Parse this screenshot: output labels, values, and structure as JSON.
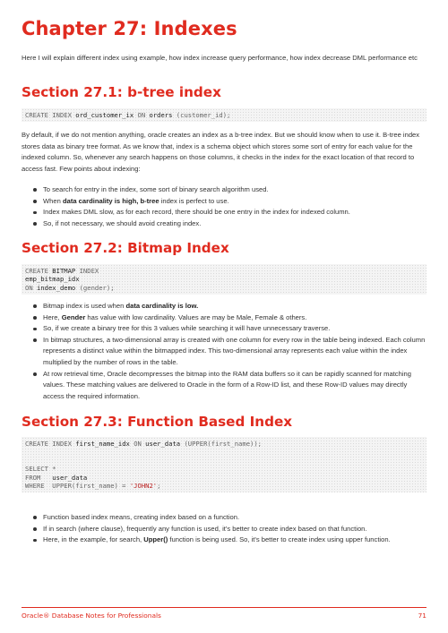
{
  "chapter": {
    "title": "Chapter 27: Indexes",
    "intro": "Here I will explain different index using example, how index increase query performance, how index decrease DML performance etc"
  },
  "s1": {
    "title": "Section 27.1: b-tree index",
    "code": [
      [
        [
          "CREATE INDEX ",
          "kw"
        ],
        [
          "ord_customer_ix",
          "id"
        ],
        [
          " ON ",
          "kw"
        ],
        [
          "orders ",
          "id"
        ],
        [
          "(customer_id);",
          "kw"
        ]
      ]
    ],
    "para": "By default, if we do not mention anything, oracle creates an index as a b-tree index. But we should know when to use it. B-tree index stores data as binary tree format. As we know that, index is a schema object which stores some sort of entry for each value for the indexed column. So, whenever any search happens on those columns, it checks in the index for the exact location of that record to access fast. Few points about indexing:",
    "bullets": [
      [
        [
          "To search for entry in the index, some sort of binary search algorithm used.",
          ""
        ]
      ],
      [
        [
          "When ",
          ""
        ],
        [
          "data cardinality is high, b-tree",
          "b"
        ],
        [
          " index is perfect to use.",
          ""
        ]
      ],
      [
        [
          "Index makes DML slow, as for each record, there should be one entry in the index for indexed column.",
          ""
        ]
      ],
      [
        [
          "So, if not necessary, we should avoid creating index.",
          ""
        ]
      ]
    ]
  },
  "s2": {
    "title": "Section 27.2: Bitmap Index",
    "code": [
      [
        [
          "CREATE ",
          "kw"
        ],
        [
          "BITMAP ",
          "id"
        ],
        [
          "INDEX",
          "kw"
        ]
      ],
      [
        [
          "emp_bitmap_idx",
          "id"
        ]
      ],
      [
        [
          "ON ",
          "kw"
        ],
        [
          "index_demo ",
          "id"
        ],
        [
          "(gender);",
          "kw"
        ]
      ]
    ],
    "bullets": [
      [
        [
          "Bitmap index is used when ",
          ""
        ],
        [
          "data cardinality is low.",
          "b"
        ]
      ],
      [
        [
          "Here, ",
          ""
        ],
        [
          "Gender",
          "b"
        ],
        [
          " has value with low cardinality. Values are may be Male, Female & others.",
          ""
        ]
      ],
      [
        [
          "So, if we create a binary tree for this 3 values while searching it will have unnecessary traverse.",
          ""
        ]
      ],
      [
        [
          "In bitmap structures, a two-dimensional array is created with one column for every row in the table being indexed. Each column represents a distinct value within the bitmapped index. This two-dimensional array represents each value within the index multiplied by the number of rows in the table.",
          ""
        ]
      ],
      [
        [
          "At row retrieval time, Oracle decompresses the bitmap into the RAM data buffers so it can be rapidly scanned for matching values. These matching values are delivered to Oracle in the form of a Row-ID list, and these Row-ID values may directly access the required information.",
          ""
        ]
      ]
    ]
  },
  "s3": {
    "title": "Section 27.3: Function Based Index",
    "code": [
      [
        [
          "CREATE INDEX ",
          "kw"
        ],
        [
          "first_name_idx ",
          "id"
        ],
        [
          "ON ",
          "kw"
        ],
        [
          "user_data ",
          "id"
        ],
        [
          "(UPPER(first_name));",
          "kw"
        ]
      ],
      [
        [
          "",
          ""
        ]
      ],
      [
        [
          "",
          ""
        ]
      ],
      [
        [
          "SELECT ",
          "kw"
        ],
        [
          "*",
          "kw"
        ]
      ],
      [
        [
          "FROM   ",
          "kw"
        ],
        [
          "user_data",
          "id"
        ]
      ],
      [
        [
          "WHERE  UPPER(first_name) = ",
          "kw"
        ],
        [
          "'JOHN2'",
          "str"
        ],
        [
          ";",
          "kw"
        ]
      ]
    ],
    "bullets": [
      [
        [
          "Function based index means, creating index based on a function.",
          ""
        ]
      ],
      [
        [
          "If in search (where clause), frequently any function is used, it's better to create index based on that function.",
          ""
        ]
      ],
      [
        [
          "Here, in the example, for search, ",
          ""
        ],
        [
          "Upper()",
          "b"
        ],
        [
          " function is being used. So, it's better to create index using upper function.",
          ""
        ]
      ]
    ]
  },
  "footer": {
    "book": "Oracle® Database Notes for Professionals",
    "page": "71"
  }
}
